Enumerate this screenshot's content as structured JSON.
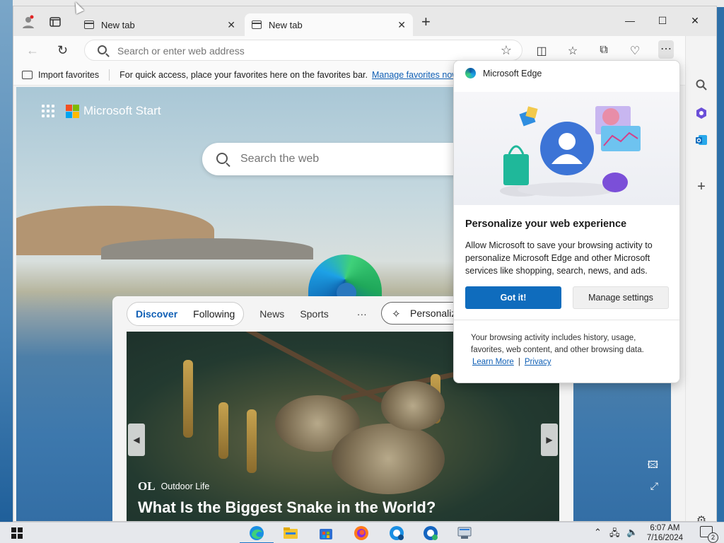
{
  "browser": {
    "tabs": [
      {
        "title": "New tab",
        "active": false
      },
      {
        "title": "New tab",
        "active": true
      }
    ],
    "address": {
      "placeholder": "Search or enter web address"
    },
    "favorites_bar": {
      "import": "Import favorites",
      "hint": "For quick access, place your favorites here on the favorites bar.",
      "manage": "Manage favorites now"
    }
  },
  "newtab": {
    "brand": "Microsoft Start",
    "search_placeholder": "Search the web",
    "feed_tabs": {
      "active": "Discover",
      "following": "Following",
      "others": [
        "News",
        "Sports"
      ],
      "more": "···",
      "personalize": "Personalize"
    },
    "hero": {
      "source_logo": "OL",
      "source": "Outdoor Life",
      "headline": "What Is the Biggest Snake in the World?"
    }
  },
  "popup": {
    "app_name": "Microsoft Edge",
    "title": "Personalize your web experience",
    "body": "Allow Microsoft to save your browsing activity to personalize Microsoft Edge and other Microsoft services like shopping, search, news, and ads.",
    "primary_button": "Got it!",
    "secondary_button": "Manage settings",
    "footer": "Your browsing activity includes history, usage, favorites, web content, and other browsing data.",
    "learn_more": "Learn More",
    "separator": "|",
    "privacy": "Privacy"
  },
  "taskbar": {
    "time": "6:07 AM",
    "date": "7/16/2024",
    "notifications": "2"
  },
  "colors": {
    "accent": "#0f6cbd",
    "link": "#0f5fb5"
  }
}
